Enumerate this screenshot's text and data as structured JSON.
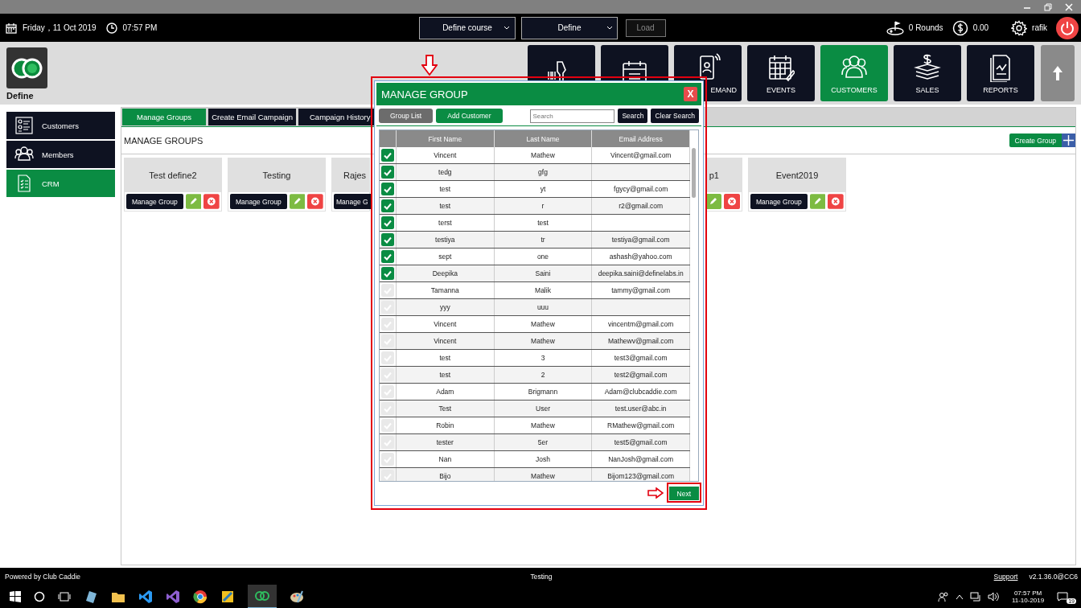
{
  "header": {
    "date": "Friday，11 Oct 2019",
    "time": "07:57 PM",
    "course_select": "Define course",
    "define_select": "Define",
    "load_button": {
      "label": "Load",
      "disabled": true
    },
    "rounds": "0 Rounds",
    "balance": "0.00",
    "user": "rafik"
  },
  "app": {
    "name": "Define"
  },
  "nav_tiles": [
    {
      "kind": "scanner",
      "selected": false
    },
    {
      "kind": "calendar",
      "selected": false
    },
    {
      "kind": "phone",
      "label": "EMAND",
      "selected": false
    },
    {
      "kind": "events",
      "label": "EVENTS",
      "selected": false
    },
    {
      "kind": "customers",
      "label": "CUSTOMERS",
      "selected": true
    },
    {
      "kind": "sales",
      "label": "SALES",
      "selected": false
    },
    {
      "kind": "reports",
      "label": "REPORTS",
      "selected": false
    }
  ],
  "sidebar": {
    "items": [
      {
        "kind": "customers",
        "label": "Customers",
        "selected": false
      },
      {
        "kind": "members",
        "label": "Members",
        "selected": false
      },
      {
        "kind": "crm",
        "label": "CRM",
        "selected": true
      }
    ]
  },
  "tabs": [
    {
      "label": "Manage Groups",
      "selected": true
    },
    {
      "label": "Create Email Campaign",
      "selected": false
    },
    {
      "label": "Campaign History",
      "selected": false
    }
  ],
  "section_title": "MANAGE GROUPS",
  "create_group_button": "Create Group",
  "groups": [
    {
      "kind": "full",
      "name": "Test define2",
      "manage_button": "Manage Group"
    },
    {
      "kind": "full",
      "name": "Testing",
      "manage_button": "Manage Group"
    },
    {
      "kind": "cut_right",
      "name": "Rajes",
      "manage_button": "Manage G"
    },
    {
      "kind": "cut_left",
      "name": "p1"
    },
    {
      "kind": "full",
      "name": "Event2019",
      "manage_button": "Manage Group"
    }
  ],
  "modal": {
    "title": "MANAGE GROUP",
    "close": "X",
    "buttons": [
      {
        "kind": "grey",
        "label": "Group List"
      },
      {
        "kind": "green",
        "label": "Add Customer"
      }
    ],
    "search": {
      "placeholder": "Search"
    },
    "search_button": "Search",
    "clear_button": "Clear Search",
    "columns": [
      "First Name",
      "Last Name",
      "Email Address"
    ],
    "rows": [
      {
        "first": "Vincent",
        "last": "Mathew",
        "email": "Vincent@gmail.com",
        "checked": true
      },
      {
        "first": "tedg",
        "last": "gfg",
        "checked": true
      },
      {
        "first": "test",
        "last": "yt",
        "email": "fgycy@gmail.com",
        "checked": true
      },
      {
        "first": "test",
        "last": "r",
        "email": "r2@gmail.com",
        "checked": true
      },
      {
        "first": "terst",
        "last": "test",
        "checked": true
      },
      {
        "first": "testiya",
        "last": "tr",
        "email": "testiya@gmail.com",
        "checked": true
      },
      {
        "first": "sept",
        "last": "one",
        "email": "ashash@yahoo.com",
        "checked": true
      },
      {
        "first": "Deepika",
        "last": "Saini",
        "email": "deepika.saini@definelabs.in",
        "checked": true
      },
      {
        "first": "Tamanna",
        "last": "Malik",
        "email": "tammy@gmail.com",
        "checked": false
      },
      {
        "first": "yyy",
        "last": "uuu",
        "checked": false
      },
      {
        "first": "Vincent",
        "last": "Mathew",
        "email": "vincentm@gmail.com",
        "checked": false
      },
      {
        "first": "Vincent",
        "last": "Mathew",
        "email": "Mathewv@gmail.com",
        "checked": false
      },
      {
        "first": "test",
        "last": "3",
        "email": "test3@gmail.com",
        "checked": false
      },
      {
        "first": "test",
        "last": "2",
        "email": "test2@gmail.com",
        "checked": false
      },
      {
        "first": "Adam",
        "last": "Brigmann",
        "email": "Adam@clubcaddie.com",
        "checked": false
      },
      {
        "first": "Test",
        "last": "User",
        "email": "test.user@abc.in",
        "checked": false
      },
      {
        "first": "Robin",
        "last": "Mathew",
        "email": "RMathew@gmail.com",
        "checked": false
      },
      {
        "first": "tester",
        "last": "5er",
        "email": "test5@gmail.com",
        "checked": false
      },
      {
        "first": "Nan",
        "last": "Josh",
        "email": "NanJosh@gmail.com",
        "checked": false
      },
      {
        "first": "Bijo",
        "last": "Mathew",
        "email": "Bijom123@gmail.com",
        "checked": false
      }
    ],
    "next_button": "Next"
  },
  "footer": {
    "powered": "Powered by Club Caddie",
    "center": "Testing",
    "support": "Support",
    "version": "v2.1.36.0@CC6"
  },
  "taskbar": {
    "time": "07:57 PM",
    "date": "11-10-2019",
    "badge": "19"
  }
}
